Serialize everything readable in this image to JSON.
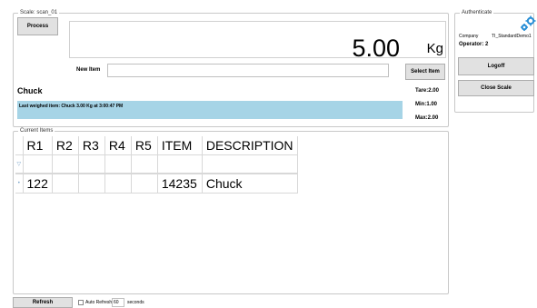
{
  "scale_group": {
    "legend": "Scale: scan_01"
  },
  "toolbar": {
    "process_label": "Process"
  },
  "weight": {
    "value": "5.00",
    "unit": "Kg"
  },
  "new_item": {
    "label": "New Item",
    "value": "",
    "select_label": "Select Item"
  },
  "item": {
    "name": "Chuck",
    "tare": "Tare:2.00",
    "min": "Min:1.00",
    "max": "Max:2.00"
  },
  "status": {
    "last_weighed": "Last weighed item: Chuck 3.00 Kg at 3:00:47 PM"
  },
  "auth": {
    "legend": "Authenticate",
    "company_label": "Company",
    "company_value": "TI_StandardDemo1",
    "operator": "Operator: 2",
    "logoff_label": "Logoff",
    "close_label": "Close Scale"
  },
  "current_items": {
    "legend": "Current Items",
    "columns": [
      "R1",
      "R2",
      "R3",
      "R4",
      "R5",
      "ITEM",
      "DESCRIPTION"
    ],
    "rows": [
      {
        "r1": "122",
        "r2": "",
        "r3": "",
        "r4": "",
        "r5": "",
        "item": "14235",
        "description": "Chuck"
      }
    ]
  },
  "footer": {
    "refresh_label": "Refresh",
    "auto_refresh_label": "Auto Refresh",
    "interval_value": "60",
    "seconds_label": "seconds"
  },
  "colors": {
    "status_bar": "#a6d4e6",
    "gear": "#2a8fd6"
  },
  "icons": {
    "settings": "gear-icon"
  }
}
